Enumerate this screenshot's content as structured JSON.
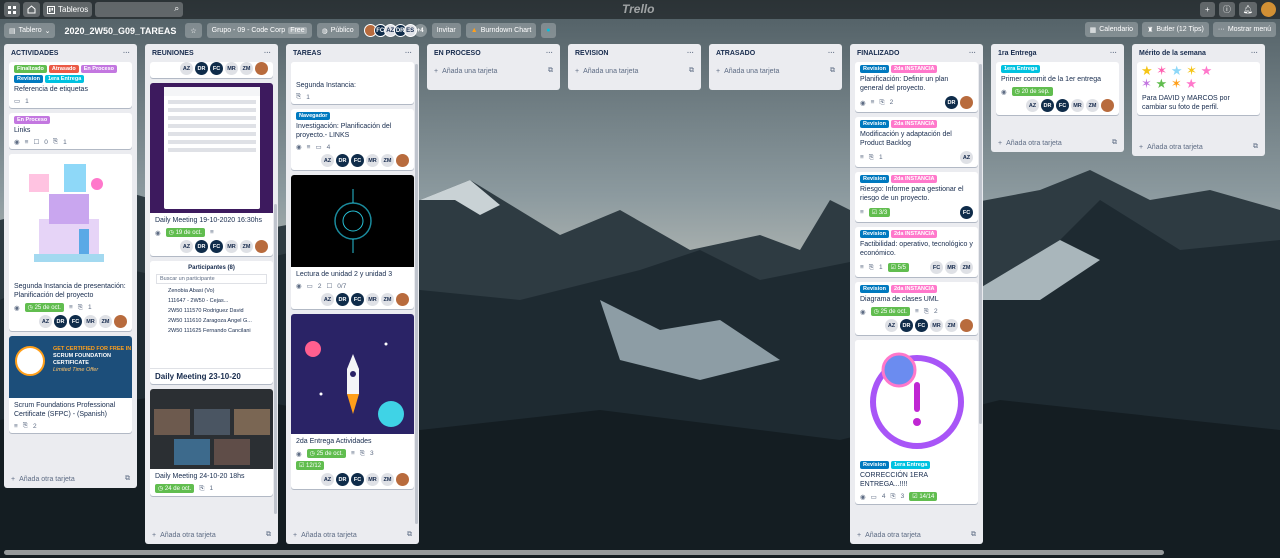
{
  "topbar": {
    "home_icon": "home-icon",
    "boards_label": "Tableros",
    "search_icon": "search-icon",
    "logo": "Trello",
    "plus_icon": "plus-icon",
    "info_icon": "info-icon",
    "bell_icon": "bell-icon"
  },
  "boardbar": {
    "view_label": "Tablero",
    "title": "2020_2W50_G09_TAREAS",
    "team_label": "Grupo - 09 - Code Corp",
    "team_badge": "Free",
    "visibility_label": "Público",
    "members": [
      "AZ",
      "FC",
      "AZ",
      "DR",
      "ES"
    ],
    "members_more": "+4",
    "invite_label": "Invitar",
    "burndown_label": "Burndown Chart",
    "calendar_label": "Calendario",
    "butler_label": "Butler (12 Tips)",
    "menu_label": "Mostrar menú"
  },
  "colors": {
    "label_green": "#61bd4f",
    "label_orange": "#ff9f1a",
    "label_red": "#eb5a46",
    "label_purple": "#c377e0",
    "label_blue": "#0079bf",
    "label_sky": "#00c2e0",
    "label_pink": "#ff78cb"
  },
  "lists": {
    "actividades": {
      "title": "ACTIVIDADES",
      "add": "Añada otra tarjeta",
      "c1": {
        "labels": [
          "Finalizado",
          "Atrasado",
          "En Proceso",
          "Revision",
          "1era Entrega"
        ],
        "title": "Referencia de etiquetas",
        "comments": "1"
      },
      "c2": {
        "labels": [
          "En Proceso"
        ],
        "title": "Links",
        "checks": "0",
        "attach": "1"
      },
      "c3": {
        "title": "Segunda Instancia de presentación: Planificación del proyecto",
        "date": "25 de oct.",
        "members": [
          "AZ",
          "DR",
          "FC",
          "MR",
          "ZM"
        ]
      },
      "c4": {
        "cover_line1": "GET CERTIFIED FOR FREE IN",
        "cover_line2": "SCRUM FOUNDATION",
        "cover_line3": "CERTIFICATE",
        "cover_line4": "Limited Time Offer",
        "title": "Scrum Foundations Professional Certificate (SFPC) - (Spanish)",
        "checks": "2"
      }
    },
    "reuniones": {
      "title": "REUNIONES",
      "add": "Añada otra tarjeta",
      "c0": {
        "members": [
          "AZ",
          "DR",
          "FC",
          "MR",
          "ZM"
        ]
      },
      "c1": {
        "title": "Daily Meeting 19-10-2020 16:30hs",
        "date": "19 de oct.",
        "members": [
          "AZ",
          "DR",
          "FC",
          "MR",
          "ZM"
        ]
      },
      "c2": {
        "panel_title": "Participantes (8)",
        "search": "Buscar un participante",
        "people": [
          "Zenobia Abasi (Vo)",
          "111647 - 2W50 - Cejas...",
          "2W50 111570 Rodriguez David",
          "2W50 111610 Zaragoza Angel G...",
          "2W50 111625 Fernando Cancilani"
        ],
        "title": "Daily Meeting 23-10-20"
      },
      "c3": {
        "title": "Daily Meeting 24-10-20 18hs",
        "date": "24 de oct.",
        "checks": "1"
      }
    },
    "tareas": {
      "title": "TAREAS",
      "add": "Añada otra tarjeta",
      "c0": {
        "title": "Segunda Instancia:",
        "comments": "1"
      },
      "c1": {
        "labels": [
          "Navegador"
        ],
        "title": "Investigación: Planificación del proyecto.- LINKS",
        "comments": "4",
        "members": [
          "AZ",
          "DR",
          "FC",
          "MR",
          "ZM"
        ]
      },
      "c2": {
        "title": "Lectura de unidad 2 y unidad 3",
        "comments": "2",
        "checks": "0/7",
        "members": [
          "AZ",
          "DR",
          "FC",
          "MR",
          "ZM"
        ]
      },
      "c3": {
        "title": "2da Entrega Actividades",
        "date": "25 de oct.",
        "attach": "3",
        "checklist": "12/12",
        "members": [
          "AZ",
          "DR",
          "FC",
          "MR",
          "ZM"
        ]
      }
    },
    "en_proceso": {
      "title": "EN PROCESO",
      "add": "Añada una tarjeta"
    },
    "revision": {
      "title": "REVISION",
      "add": "Añada una tarjeta"
    },
    "atrasado": {
      "title": "ATRASADO",
      "add": "Añada una tarjeta"
    },
    "finalizado": {
      "title": "FINALIZADO",
      "add": "Añada otra tarjeta",
      "c1": {
        "labels": [
          "Revision",
          "2da INSTANCIA"
        ],
        "title": "Planificación: Definir un plan general del proyecto.",
        "comments": "2",
        "members": [
          "DR"
        ]
      },
      "c2": {
        "labels": [
          "Revision",
          "2da INSTANCIA"
        ],
        "title": "Modificación y adaptación del Product Backlog",
        "attach": "1",
        "members": [
          "AZ"
        ]
      },
      "c3": {
        "labels": [
          "Revision",
          "2da INSTANCIA"
        ],
        "title": "Riesgo: Informe para gestionar el riesgo de un proyecto.",
        "checklist": "3/3",
        "members": [
          "FC"
        ]
      },
      "c4": {
        "labels": [
          "Revision",
          "2da INSTANCIA"
        ],
        "title": "Factibilidad: operativo, tecnológico y económico.",
        "attach": "1",
        "checklist": "5/5",
        "members": [
          "FC",
          "MR",
          "ZM"
        ]
      },
      "c5": {
        "labels": [
          "Revision",
          "2da INSTANCIA"
        ],
        "title": "Diagrama de clases UML",
        "date": "25 de oct.",
        "attach": "2",
        "members": [
          "AZ",
          "DR",
          "FC",
          "MR",
          "ZM"
        ]
      },
      "c6": {
        "labels": [
          "Revision",
          "1era Entrega"
        ],
        "title": "CORRECCIÓN 1ERA ENTREGA...!!!!",
        "comments": "4",
        "attach": "3",
        "checklist": "14/14"
      }
    },
    "primera": {
      "title": "1ra Entrega",
      "add": "Añada otra tarjeta",
      "c1": {
        "labels": [
          "1era Entrega"
        ],
        "title": "Primer commit de la 1er entrega",
        "date": "20 de sep.",
        "members": [
          "AZ",
          "DR",
          "FC",
          "MR",
          "ZM"
        ]
      }
    },
    "merito": {
      "title": "Mérito de la semana",
      "add": "Añada otra tarjeta",
      "c1": {
        "title": "Para DAVID y MARCOS por cambiar su foto de perfil."
      }
    }
  }
}
